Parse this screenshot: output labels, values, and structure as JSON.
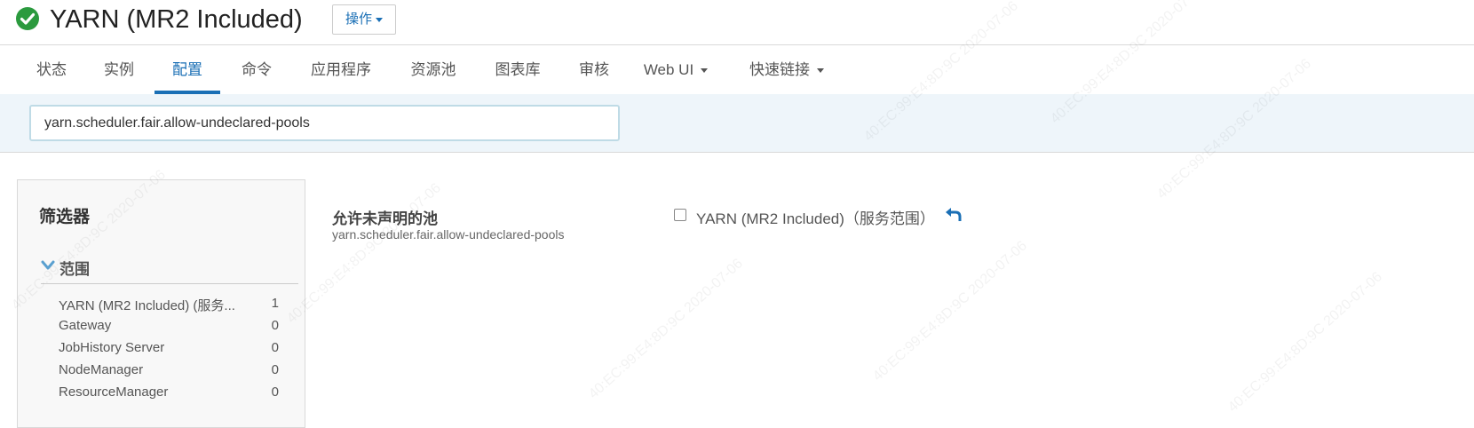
{
  "header": {
    "title": "YARN (MR2 Included)",
    "actions_label": "操作",
    "status_color": "#2b9a3e"
  },
  "tabs": [
    {
      "label": "状态"
    },
    {
      "label": "实例"
    },
    {
      "label": "配置",
      "active": true
    },
    {
      "label": "命令"
    },
    {
      "label": "应用程序"
    },
    {
      "label": "资源池"
    },
    {
      "label": "图表库"
    },
    {
      "label": "审核"
    },
    {
      "label": "Web UI",
      "dropdown": true
    },
    {
      "label": "快速链接",
      "dropdown": true
    }
  ],
  "search": {
    "value": "yarn.scheduler.fair.allow-undeclared-pools"
  },
  "filters": {
    "title": "筛选器",
    "scope_label": "范围",
    "items": [
      {
        "name": "YARN (MR2 Included) (服务...",
        "count": "1"
      },
      {
        "name": "Gateway",
        "count": "0"
      },
      {
        "name": "JobHistory Server",
        "count": "0"
      },
      {
        "name": "NodeManager",
        "count": "0"
      },
      {
        "name": "ResourceManager",
        "count": "0"
      }
    ]
  },
  "property": {
    "display_name": "允许未声明的池",
    "key": "yarn.scheduler.fair.allow-undeclared-pools",
    "scope_label": "YARN (MR2 Included)（服务范围）",
    "checked": false
  },
  "watermark_text": "40:EC:99:E4:8D:9C 2020-07-06",
  "colors": {
    "accent": "#1a6fb5",
    "search_band": "#eef5fa"
  }
}
